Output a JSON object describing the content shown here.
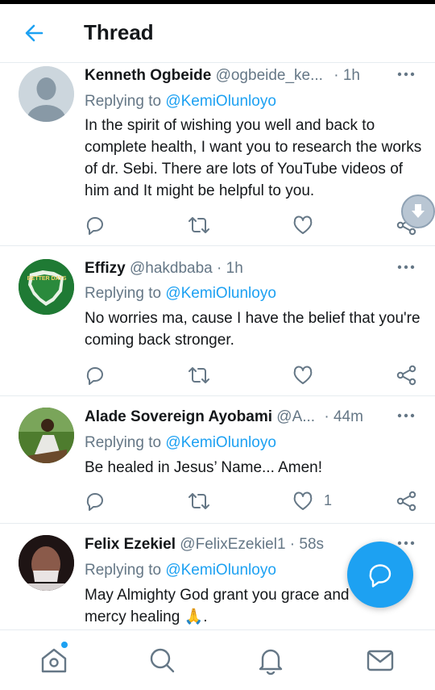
{
  "header": {
    "title": "Thread",
    "back_icon": "back-arrow-icon"
  },
  "colors": {
    "accent": "#1da1f2",
    "secondary_text": "#657786",
    "primary_text": "#14171a",
    "divider": "#e6ecf0"
  },
  "replies": [
    {
      "name": "Kenneth Ogbeide",
      "handle": "@ogbeide_ke...",
      "dot": "·",
      "time": "1h",
      "replying_prefix": "Replying to",
      "replying_to": "@KemiOlunloyo",
      "body": "In the spirit of wishing you well and back to complete health, I want you to research the works of dr. Sebi. There are lots of YouTube videos of him and It might be helpful to you.",
      "like_count": ""
    },
    {
      "name": "Effizy",
      "handle": "@hakdbaba",
      "dot": "·",
      "time": "1h",
      "replying_prefix": "Replying to",
      "replying_to": "@KemiOlunloyo",
      "body": "No worries ma, cause I have the belief that you're coming back stronger.",
      "avatar_text": "BETTER DAYS",
      "like_count": ""
    },
    {
      "name": "Alade Sovereign Ayobami",
      "handle": "@A...",
      "dot": "·",
      "time": "44m",
      "replying_prefix": "Replying to",
      "replying_to": "@KemiOlunloyo",
      "body": "Be healed in Jesus’ Name... Amen!",
      "like_count": "1"
    },
    {
      "name": "Felix Ezekiel",
      "handle": "@FelixEzekiel1",
      "dot": "·",
      "time": "58s",
      "replying_prefix": "Replying to",
      "replying_to": "@KemiOlunloyo",
      "body": "May Almighty God grant you grace and mercy healing 🙏.",
      "like_count": ""
    }
  ],
  "actions": [
    "reply-icon",
    "retweet-icon",
    "like-icon",
    "share-icon"
  ],
  "bottom_nav": [
    "home-icon",
    "search-icon",
    "notifications-icon",
    "messages-icon"
  ],
  "fab": {
    "icon": "compose-reply-icon"
  }
}
